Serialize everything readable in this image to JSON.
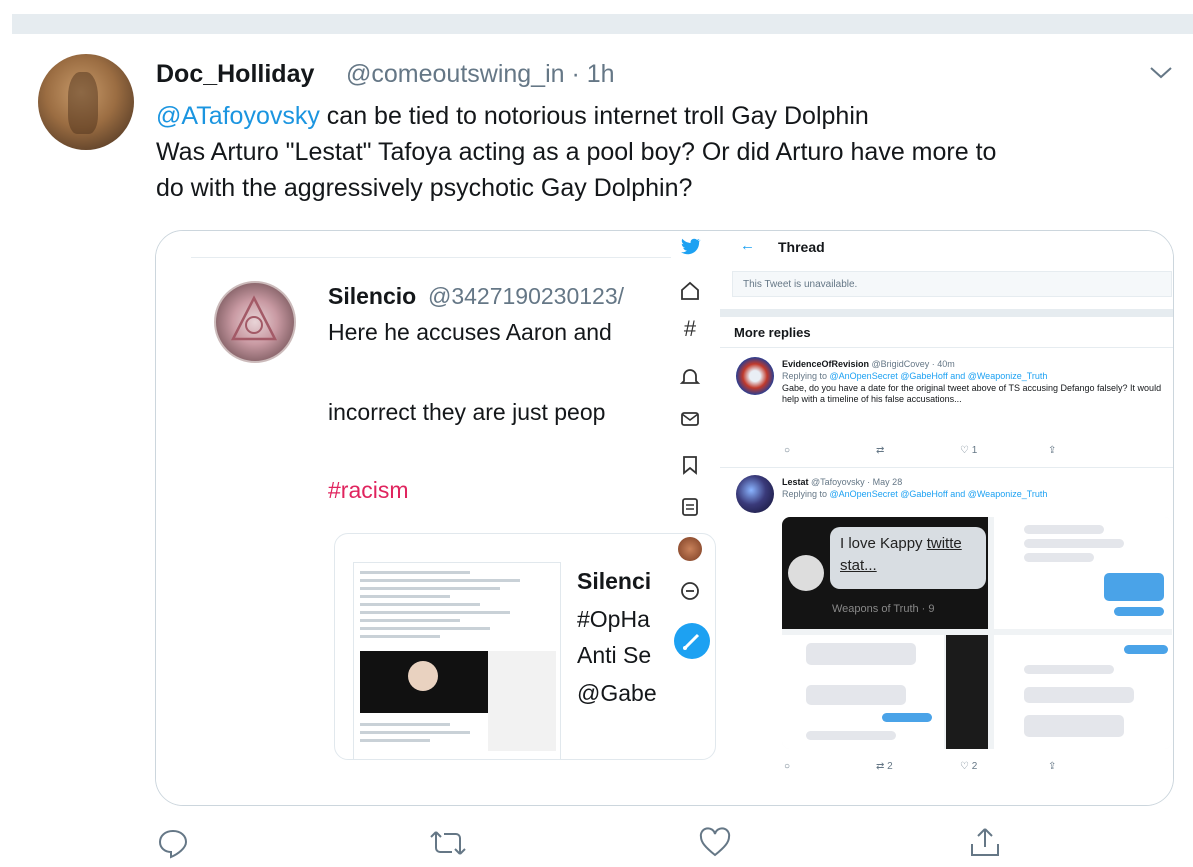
{
  "tweet": {
    "author_name": "Doc_Holliday",
    "meta": "@comeoutswing_in · 1h",
    "line1_mention": "@ATafoyovsky",
    "line1_rest": " can be tied to notorious internet troll Gay Dolphin",
    "line2": "Was Arturo \"Lestat\" Tafoya acting as a pool boy? Or did Arturo have more to",
    "line3": "do with the aggressively psychotic Gay Dolphin?"
  },
  "left_panel": {
    "name": "Silencio",
    "handle": "@3427190230123/",
    "line1": "Here he accuses Aaron and",
    "line2": "incorrect they are just peop",
    "hashtag": "#racism",
    "quote_lines": [
      "Silenci",
      "#OpHa",
      "Anti Se",
      "@Gabe"
    ]
  },
  "right_panel": {
    "title": "Thread",
    "unavailable": "This Tweet is unavailable.",
    "more_replies": "More replies",
    "reply1": {
      "name": "EvidenceOfRevision",
      "meta": "@BrigidCovey · 40m",
      "replying_prefix": "Replying to ",
      "replying_to": "@AnOpenSecret @GabeHoff and @Weaponize_Truth",
      "body": "Gabe, do you have a date for the original tweet above of TS accusing Defango falsely? It would help with a timeline of his false accusations...",
      "likes": "1"
    },
    "reply2": {
      "name": "Lestat",
      "meta": "@Tafoyovsky · May 28",
      "replying_prefix": "Replying to ",
      "replying_to": "@AnOpenSecret @GabeHoff and @Weaponize_Truth",
      "kappy_text_1": "I love Kappy ",
      "kappy_link": "twitte",
      "kappy_text_2": "stat...",
      "weapons_caption": "Weapons of Truth · 9",
      "retweets": "2",
      "likes": "2"
    }
  },
  "icons": {
    "chevron": "chevron-down-icon",
    "reply": "reply-icon",
    "retweet": "retweet-icon",
    "like": "heart-icon",
    "share": "share-icon"
  },
  "colors": {
    "link": "#1b95e0",
    "hashtag": "#e0245e",
    "twitter_blue": "#1da1f2"
  }
}
